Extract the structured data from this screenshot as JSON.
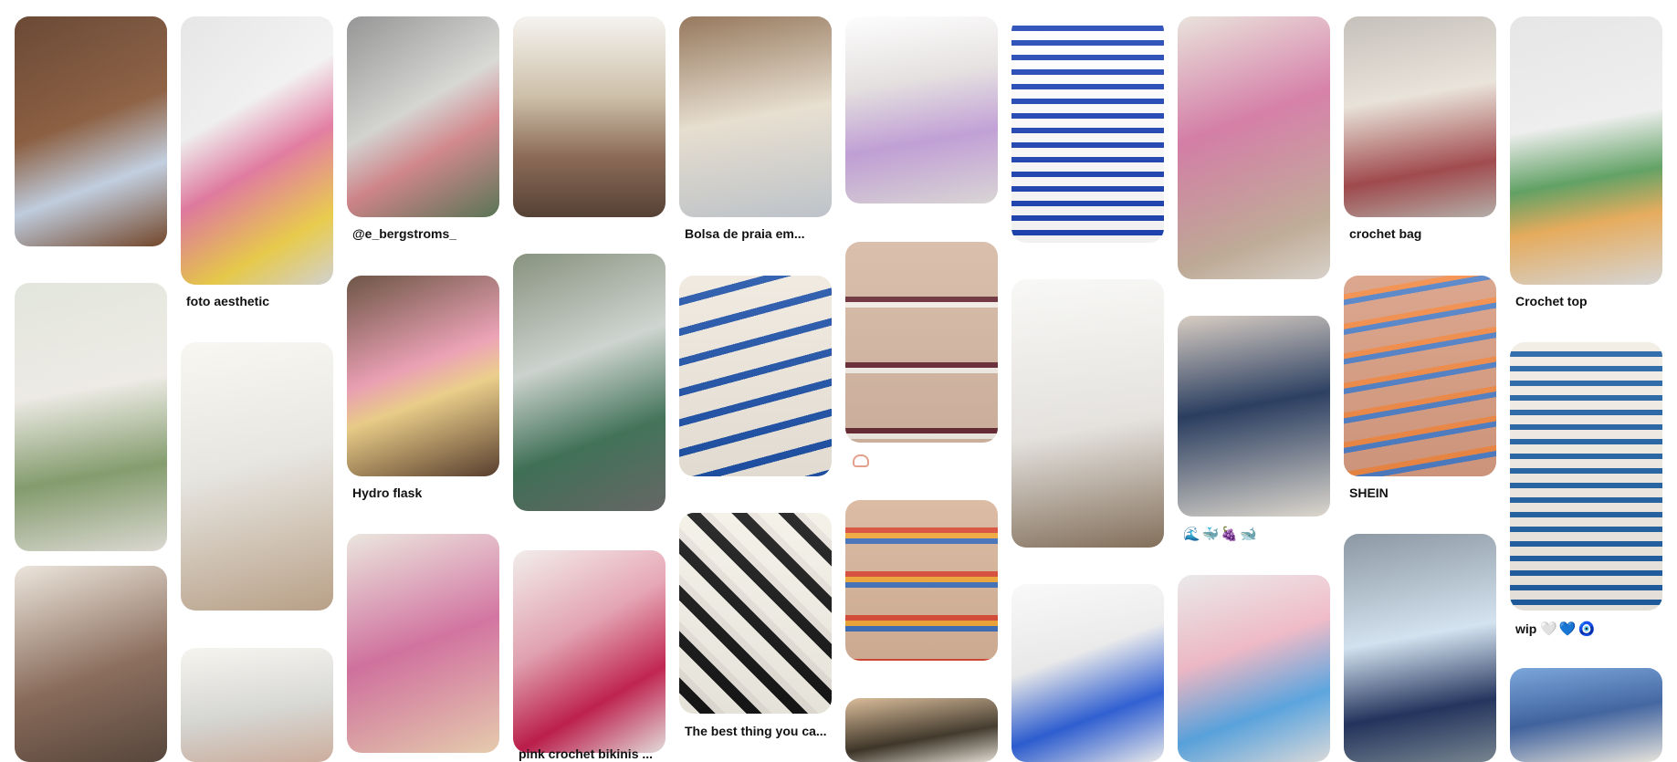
{
  "feed": {
    "pins": [
      {
        "caption": "",
        "colors": [
          "#5a3520",
          "#c8d6e8",
          "#7a4a2c"
        ]
      },
      {
        "caption": "",
        "colors": [
          "#dfe3d8",
          "#86a06e",
          "#f2efe9"
        ]
      },
      {
        "caption": "",
        "colors": [
          "#8a6a58",
          "#e9e2d8",
          "#5c4b40"
        ]
      },
      {
        "caption": "foto aesthetic",
        "colors": [
          "#e3e3e3",
          "#e77aa2",
          "#f3d44d"
        ]
      },
      {
        "caption": "",
        "colors": [
          "#ecebe6",
          "#c4aa8f",
          "#f7f6f1"
        ]
      },
      {
        "caption": "",
        "colors": [
          "#dcdcd8",
          "#d9b8a6",
          "#f5f3ee"
        ]
      },
      {
        "caption": "@e_bergstroms_",
        "colors": [
          "#d9d9d6",
          "#d88a8f",
          "#5f7c5a"
        ]
      },
      {
        "caption": "Hydro flask",
        "colors": [
          "#5d4231",
          "#f0a0b5",
          "#f2d38a"
        ]
      },
      {
        "caption": "",
        "colors": [
          "#e8e3da",
          "#d56f9f",
          "#f4d8b8"
        ]
      },
      {
        "caption": "",
        "colors": [
          "#f4f2ee",
          "#8e6b56",
          "#cfc0a7"
        ]
      },
      {
        "caption": "",
        "colors": [
          "#7a8670",
          "#3f7357",
          "#cfd6d1"
        ]
      },
      {
        "caption": "pink crochet bikinis ...",
        "colors": [
          "#f0ebe9",
          "#c51e4d",
          "#e6a1b0"
        ]
      },
      {
        "caption": "Bolsa de praia em...",
        "colors": [
          "#8b6a4c",
          "#ede4d4",
          "#c9cfd6"
        ]
      },
      {
        "caption": "",
        "colors": [
          "#d7c7b7",
          "#1f52a8",
          "#efe8de"
        ]
      },
      {
        "caption": "The best thing you ca...",
        "colors": [
          "#e7e2da",
          "#161616",
          "#f3f0e7"
        ]
      },
      {
        "caption": "",
        "colors": [
          "#e7e3e2",
          "#c7a3dd",
          "#fdfdfd"
        ]
      },
      {
        "caption": "",
        "colors": [
          "#d6b8a4",
          "#6a2c36",
          "#f5efe8"
        ]
      },
      {
        "caption": "",
        "colors": [
          "#d8b49a",
          "#d94b36",
          "#f2a737"
        ]
      },
      {
        "caption": "",
        "colors": [
          "#d6b58f",
          "#3c3325",
          "#efe9df"
        ]
      },
      {
        "caption": "",
        "colors": [
          "#f3f3f3",
          "#1f45b5",
          "#ffffff"
        ]
      },
      {
        "caption": "",
        "colors": [
          "#ebe8e4",
          "#8b7660",
          "#f7f7f5"
        ]
      },
      {
        "caption": "",
        "colors": [
          "#eeeeee",
          "#2c5fd9",
          "#f8f8f8"
        ]
      },
      {
        "caption": "",
        "colors": [
          "#e6dfd7",
          "#d77aa6",
          "#c8b39d"
        ]
      },
      {
        "caption": "",
        "colors": [
          "#d3c7bc",
          "#20355a",
          "#eae4da"
        ]
      },
      {
        "caption": "",
        "colors": [
          "#e7e7e7",
          "#f2b9c7",
          "#5aa8e6"
        ]
      },
      {
        "caption": "crochet bag",
        "colors": [
          "#bfb9b3",
          "#a64a4d",
          "#ede7dd"
        ]
      },
      {
        "caption": "SHEIN",
        "colors": [
          "#d89d82",
          "#f28a45",
          "#4f7fc6"
        ]
      },
      {
        "caption": "",
        "colors": [
          "#7f8d99",
          "#d7e7f5",
          "#20325e"
        ]
      },
      {
        "caption": "Crochet top",
        "colors": [
          "#e3e3e3",
          "#5fa463",
          "#f0b25e"
        ]
      },
      {
        "caption": "wip",
        "colors": [
          "#f1ece4",
          "#1f5fa3",
          "#fafafa"
        ]
      },
      {
        "caption": "",
        "colors": [
          "#6b9cd7",
          "#3a5f9f",
          "#f5f2ea"
        ]
      }
    ],
    "emoji_caption": "🌊🐳🍇🐋",
    "wip_emoji": "🤍💙🧿",
    "tiny_icon": "pink-lock-icon"
  }
}
